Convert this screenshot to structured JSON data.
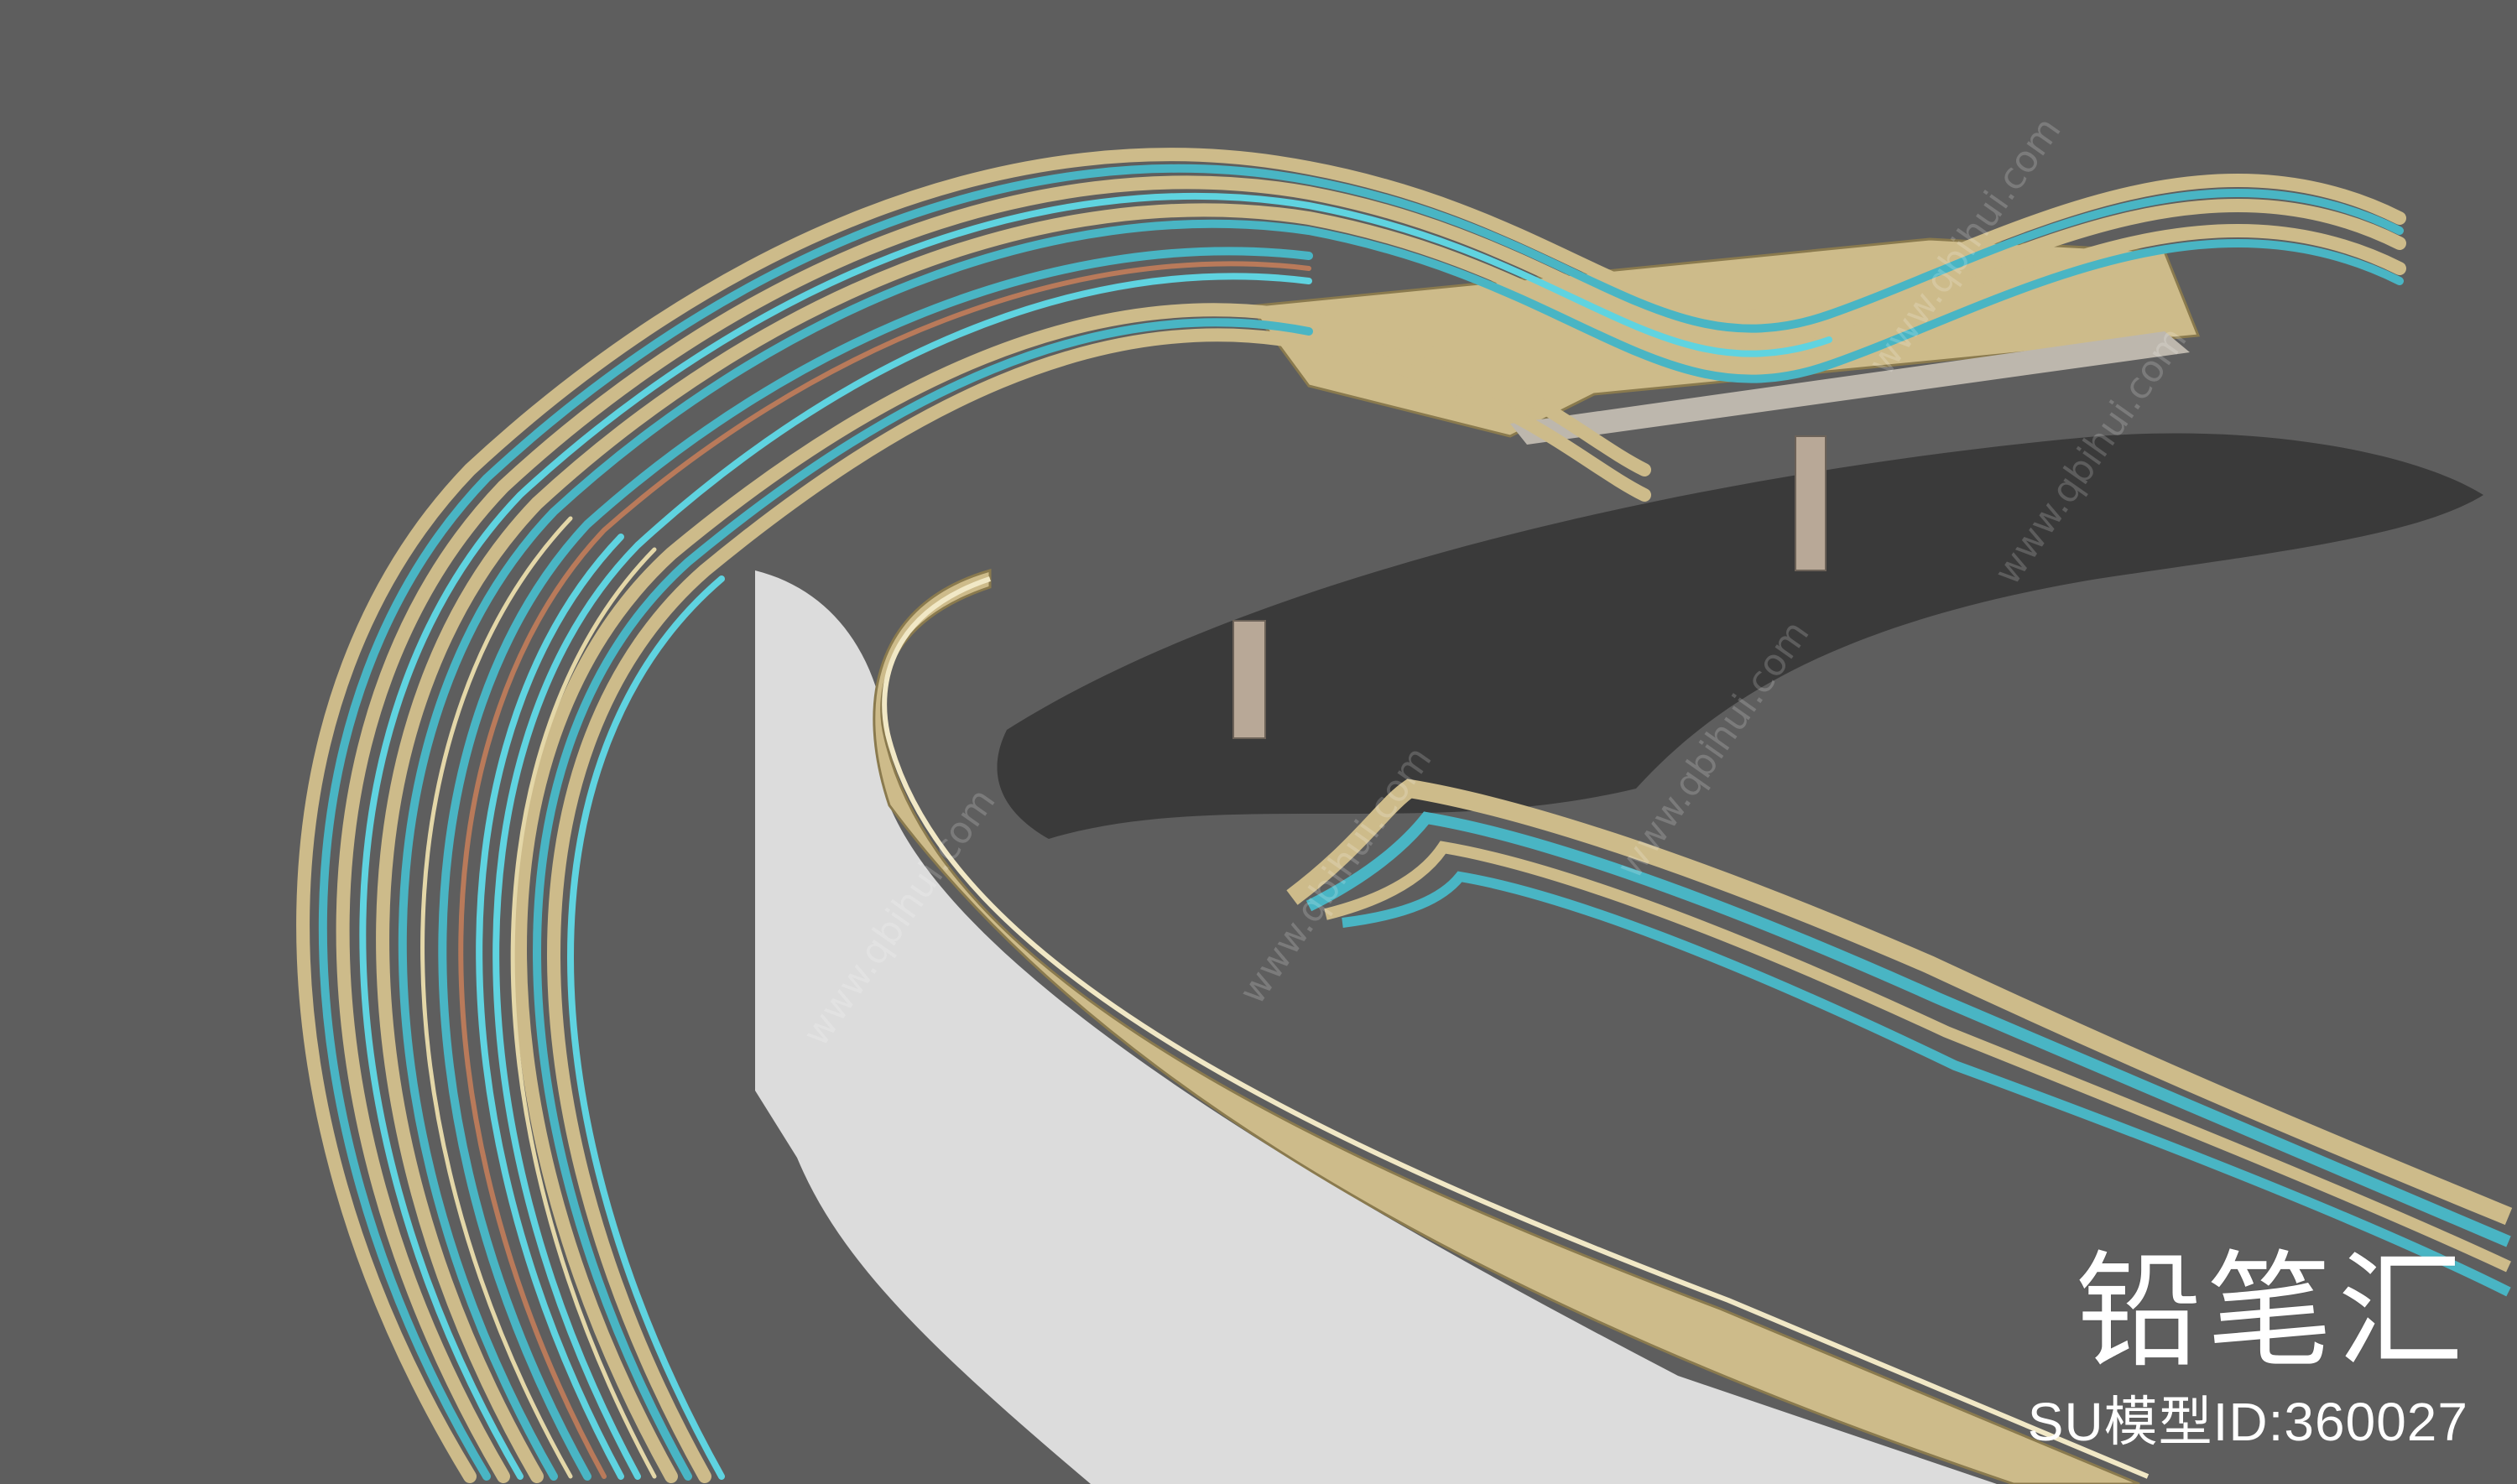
{
  "watermark": {
    "brand": "铅笔汇",
    "model_id": "SU模型ID:360027",
    "url": "www.qbihui.com"
  },
  "colors": {
    "background": "#5e5e5e",
    "shadow": "#3a3a3a",
    "floor": "#dcdcdc",
    "beige": "#cdbb8a",
    "beige_light": "#e4d7a8",
    "teal": "#49b5c4",
    "cyan": "#5fd3e0",
    "rust": "#b97a5a",
    "pillar": "#b8a897"
  }
}
